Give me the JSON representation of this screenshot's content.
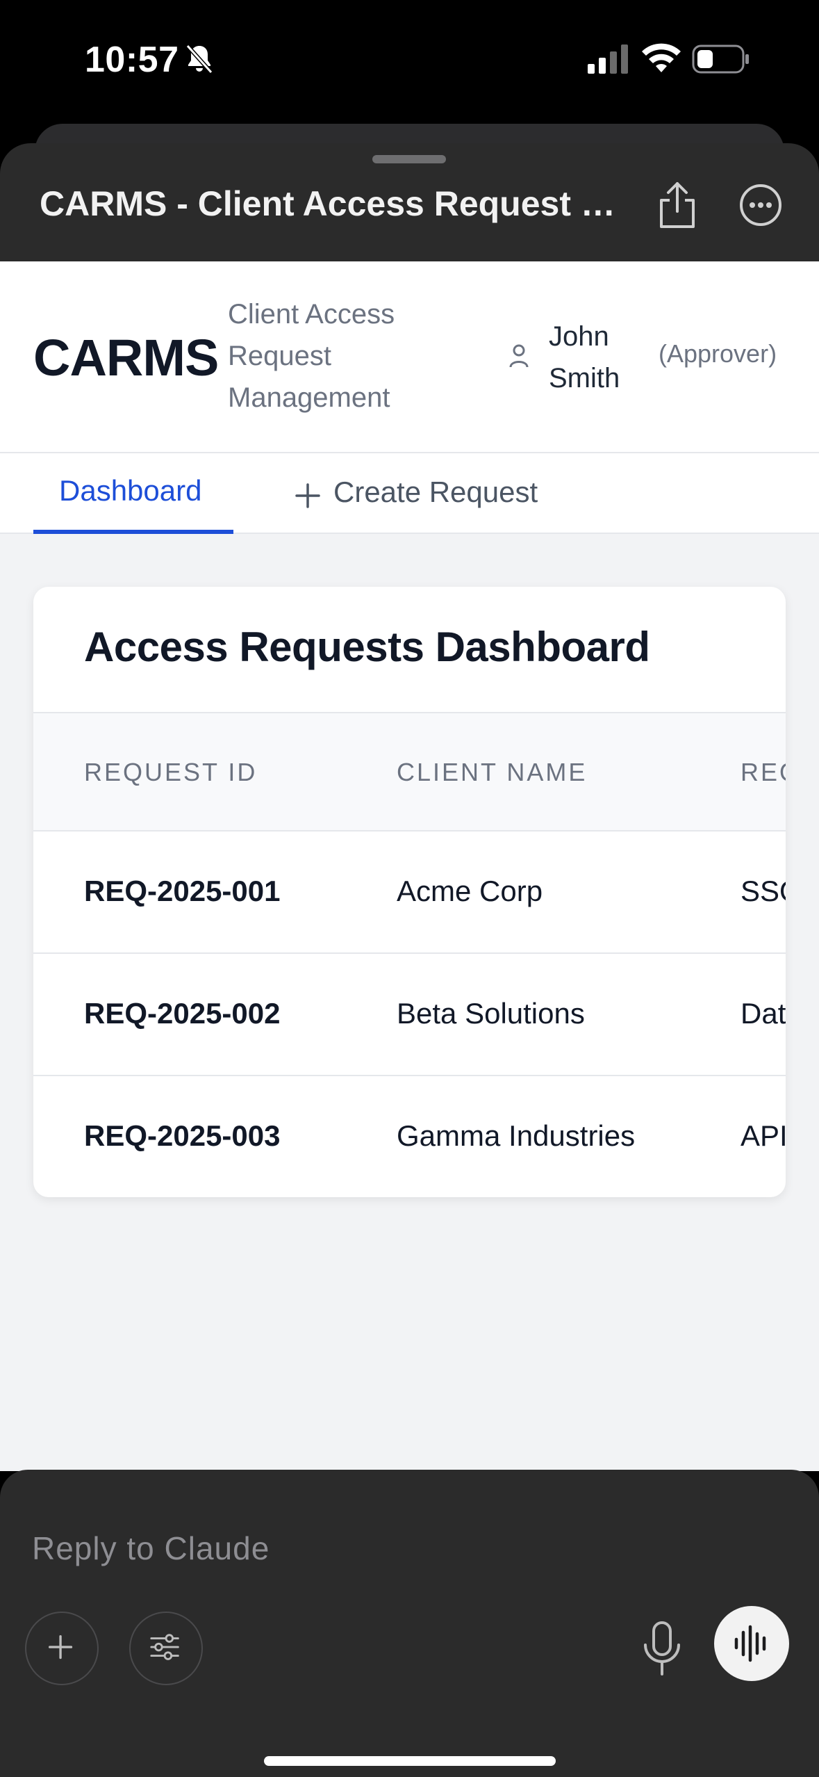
{
  "status_bar": {
    "time": "10:57",
    "icons": [
      "bell-off-icon",
      "signal-icon",
      "wifi-icon",
      "battery-icon"
    ]
  },
  "artifact": {
    "title": "CARMS - Client Access Request Management",
    "share_icon": "share-icon",
    "more_icon": "more-icon"
  },
  "app": {
    "brand": "CARMS",
    "subtitle": "Client Access Request Management",
    "user": {
      "name": "John Smith",
      "role": "(Approver)",
      "icon": "user-icon"
    },
    "tabs": [
      {
        "label": "Dashboard",
        "active": true
      },
      {
        "label": "Create Request",
        "active": false,
        "icon": "plus-icon"
      }
    ],
    "accent_color": "#1d4ed8"
  },
  "dashboard": {
    "title": "Access Requests Dashboard",
    "columns": [
      "REQUEST ID",
      "CLIENT NAME",
      "REQ"
    ],
    "rows": [
      {
        "id": "REQ-2025-001",
        "client": "Acme Corp",
        "type": "SSO"
      },
      {
        "id": "REQ-2025-002",
        "client": "Beta Solutions",
        "type": "Dat"
      },
      {
        "id": "REQ-2025-003",
        "client": "Gamma Industries",
        "type": "API"
      }
    ]
  },
  "composer": {
    "placeholder": "Reply to Claude",
    "buttons": [
      "plus-icon",
      "sliders-icon",
      "mic-icon",
      "voice-waveform-icon"
    ]
  }
}
